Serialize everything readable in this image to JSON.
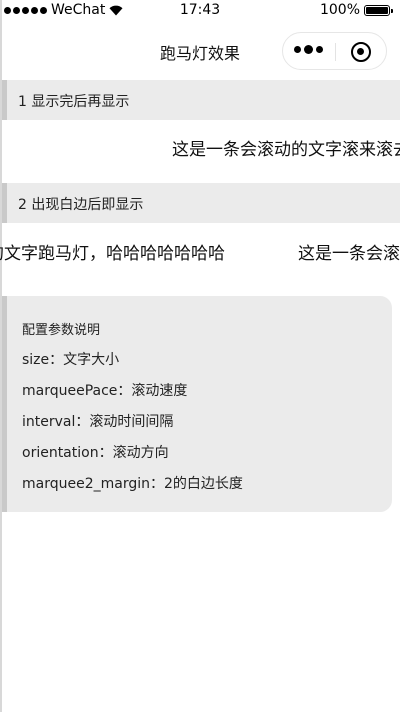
{
  "status_bar": {
    "carrier": "WeChat",
    "time": "17:43",
    "battery": "100%"
  },
  "nav": {
    "title": "跑马灯效果"
  },
  "section1": {
    "header": "1 显示完后再显示",
    "marquee_text": "这是一条会滚动的文字滚来滚去的文字跑马灯，哈哈哈哈哈哈哈"
  },
  "section2": {
    "header": "2 出现白边后即显示",
    "marquee_text_a": "这是一条会滚动的文字滚来滚去的文字跑马灯，哈哈哈哈哈哈哈",
    "marquee_text_b": "这是一条会滚动的文字滚来滚去的文字跑马灯，哈哈哈哈哈哈哈"
  },
  "config": {
    "title": "配置参数说明",
    "items": [
      "size：文字大小",
      "marqueePace：滚动速度",
      "interval：滚动时间间隔",
      "orientation：滚动方向",
      "marquee2_margin：2的白边长度"
    ]
  }
}
